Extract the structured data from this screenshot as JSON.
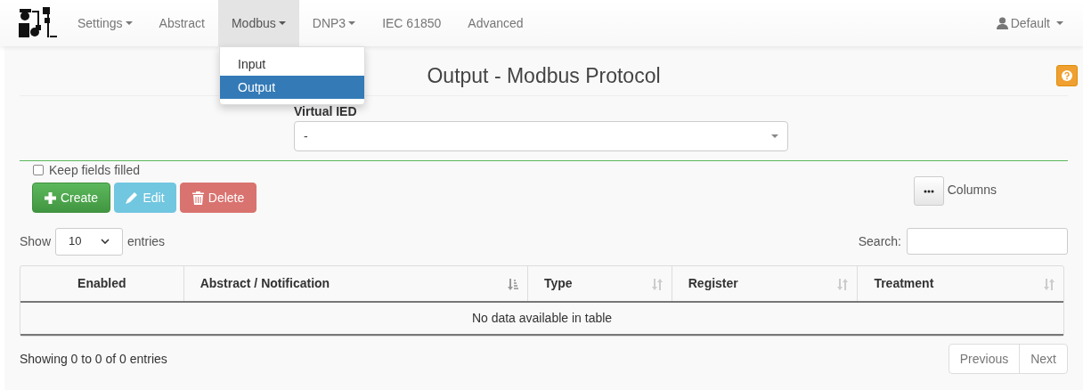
{
  "navbar": {
    "items": [
      {
        "label": "Settings",
        "dropdown": true,
        "selected": false
      },
      {
        "label": "Abstract",
        "dropdown": false,
        "selected": false
      },
      {
        "label": "Modbus",
        "dropdown": true,
        "selected": true
      },
      {
        "label": "DNP3",
        "dropdown": true,
        "selected": false
      },
      {
        "label": "IEC 61850",
        "dropdown": false,
        "selected": false
      },
      {
        "label": "Advanced",
        "dropdown": false,
        "selected": false
      }
    ],
    "user": {
      "label": "Default"
    }
  },
  "open_menu": {
    "items": [
      {
        "label": "Input",
        "selected": false
      },
      {
        "label": "Output",
        "selected": true
      }
    ]
  },
  "page": {
    "title": "Output - Modbus Protocol"
  },
  "form": {
    "virtual_ied": {
      "label": "Virtual IED",
      "value": "-"
    },
    "keep_fields_filled": {
      "label": "Keep fields filled",
      "checked": false
    }
  },
  "actions": [
    {
      "kind": "create",
      "label": "Create"
    },
    {
      "kind": "edit",
      "label": "Edit"
    },
    {
      "kind": "delete",
      "label": "Delete"
    }
  ],
  "columns_button": {
    "label": "Columns"
  },
  "table": {
    "length": {
      "before": "Show",
      "value": "10",
      "after": "entries"
    },
    "search": {
      "label": "Search:"
    },
    "columns": [
      {
        "label": "Enabled",
        "kind": "plain"
      },
      {
        "label": "Abstract / Notification",
        "kind": "sorted"
      },
      {
        "label": "Type",
        "kind": "sortable"
      },
      {
        "label": "Register",
        "kind": "sortable"
      },
      {
        "label": "Treatment",
        "kind": "sortable"
      }
    ],
    "empty_message": "No data available in table",
    "info": "Showing 0 to 0 of 0 entries",
    "pagination": [
      "Previous",
      "Next"
    ]
  }
}
